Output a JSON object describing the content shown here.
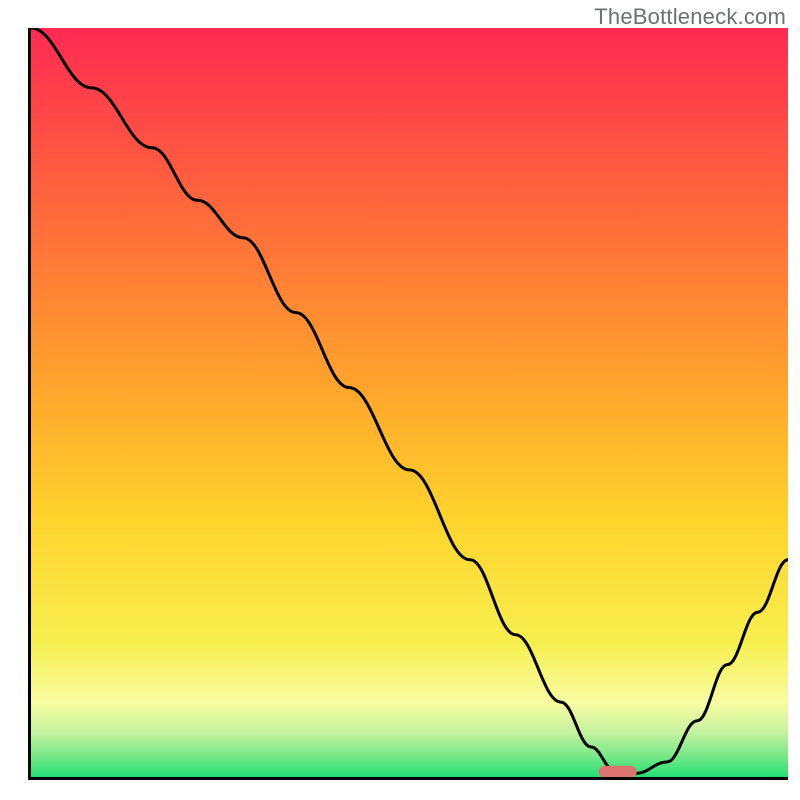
{
  "watermark": "TheBottleneck.com",
  "chart_data": {
    "type": "line",
    "title": "",
    "xlabel": "",
    "ylabel": "",
    "xlim": [
      0,
      100
    ],
    "ylim": [
      0,
      100
    ],
    "grid": false,
    "legend": false,
    "background_gradient": {
      "top": "#ff2a52",
      "middle": "#ffd22b",
      "bottom": "#24e075"
    },
    "series": [
      {
        "name": "curve",
        "color": "#000000",
        "x": [
          0,
          8,
          16,
          22,
          28,
          35,
          42,
          50,
          58,
          64,
          70,
          74,
          77,
          80,
          84,
          88,
          92,
          96,
          100
        ],
        "y": [
          100,
          92,
          84,
          77,
          72,
          62,
          52,
          41,
          29,
          19,
          10,
          4,
          1,
          0.5,
          2,
          7.5,
          15,
          22,
          29
        ]
      }
    ],
    "marker": {
      "shape": "rounded-rect",
      "color": "#df746e",
      "x": 77.5,
      "y": 0.7,
      "w": 5,
      "h": 1.6
    }
  }
}
